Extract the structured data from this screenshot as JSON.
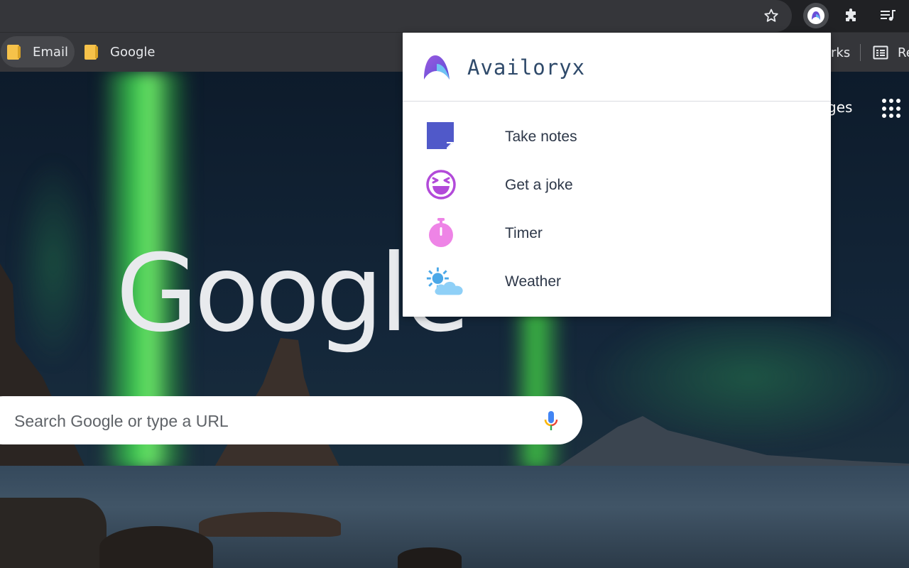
{
  "toolbar": {
    "bookmark_star_icon": "star-outline-icon",
    "extension_icon": "availoryx-extension-icon",
    "extensions_icon": "puzzle-icon",
    "media_icon": "playlist-icon"
  },
  "bookmarks_bar": {
    "items": [
      {
        "label": "Email",
        "icon": "folder-icon"
      },
      {
        "label": "Google",
        "icon": "folder-icon"
      }
    ],
    "other_bookmarks_partial": "rks",
    "reading_list_partial": "Re"
  },
  "ntp": {
    "logo_text": "Google",
    "top_link_partial": "ges",
    "search_placeholder": "Search Google or type a URL"
  },
  "popup": {
    "title": "Availoryx",
    "items": [
      {
        "label": "Take notes",
        "icon": "note-icon",
        "color": "#5059c9"
      },
      {
        "label": "Get a joke",
        "icon": "laughing-face-icon",
        "color": "#b24ad9"
      },
      {
        "label": "Timer",
        "icon": "stopwatch-icon",
        "color": "#ee84e6"
      },
      {
        "label": "Weather",
        "icon": "sun-cloud-icon",
        "color": "#7cc6f2"
      }
    ]
  }
}
